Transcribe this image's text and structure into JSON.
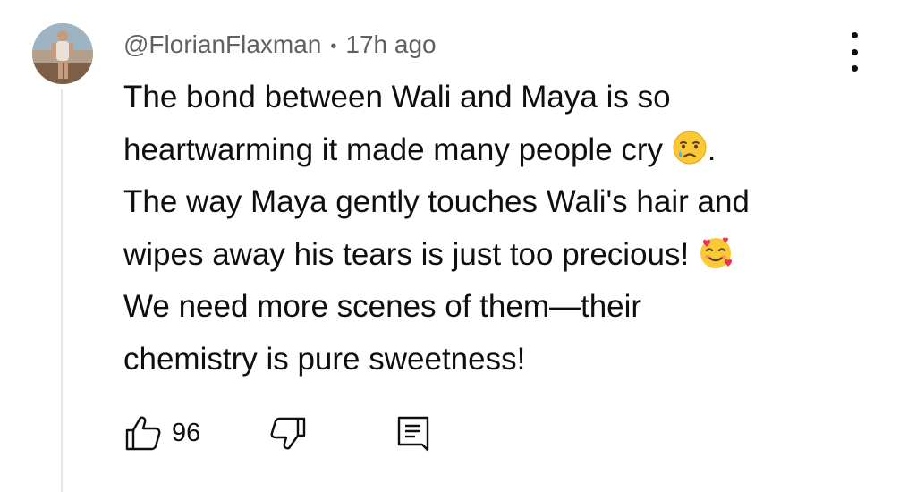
{
  "comment": {
    "author": "@FlorianFlaxman",
    "separator": "•",
    "time": "17h ago",
    "lines": [
      "The bond between Wali and Maya is so",
      "heartwarming it made many people cry",
      "The way Maya gently touches Wali's hair and",
      "wipes away his tears is just too precious!",
      "We need more scenes of them—their",
      "chemistry is pure sweetness!"
    ],
    "line2_suffix": ".",
    "emojis": [
      "crying-face",
      "smiling-face-with-hearts"
    ]
  },
  "actions": {
    "like_count": "96",
    "icons": [
      "thumbs-up-icon",
      "thumbs-down-icon",
      "reply-comment-icon",
      "more-vert-icon"
    ]
  },
  "colors": {
    "text": "#0f0f0f",
    "meta": "#606060",
    "thread_line": "#e5e5e5",
    "background": "#ffffff"
  }
}
